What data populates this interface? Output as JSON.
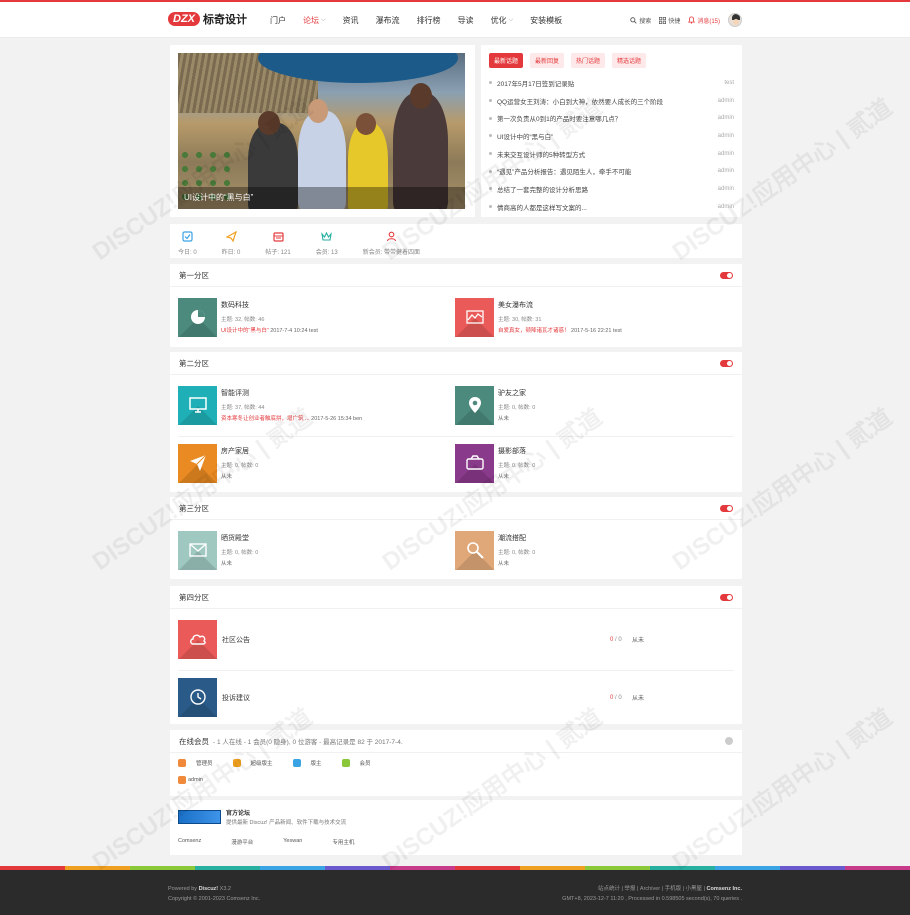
{
  "brand": {
    "badge": "DZX",
    "name": "标奇设计"
  },
  "nav": [
    {
      "label": "门户",
      "active": false,
      "caret": false
    },
    {
      "label": "论坛",
      "active": true,
      "caret": true
    },
    {
      "label": "资讯",
      "active": false,
      "caret": false
    },
    {
      "label": "瀑布流",
      "active": false,
      "caret": false
    },
    {
      "label": "排行榜",
      "active": false,
      "caret": false
    },
    {
      "label": "导读",
      "active": false,
      "caret": false
    },
    {
      "label": "优化",
      "active": false,
      "caret": true
    },
    {
      "label": "安装模板",
      "active": false,
      "caret": false
    }
  ],
  "header_right": {
    "search": "搜索",
    "quick": "快捷",
    "messages": "消息(15)"
  },
  "slide": {
    "caption": "UI设计中的“黑与白”"
  },
  "hot": {
    "tabs": [
      "最新话题",
      "最新回复",
      "热门话题",
      "精选话题"
    ],
    "items": [
      {
        "title": "2017年5月17日签到记录贴",
        "author": "test"
      },
      {
        "title": "QQ运营女王刘涛：小白到大神，依然要人成长的三个阶段",
        "author": "admin"
      },
      {
        "title": "第一次负责从0到1的产品时要注意哪几点？",
        "author": "admin"
      },
      {
        "title": "UI设计中的“黑与白”",
        "author": "admin"
      },
      {
        "title": "未来交互设计师的5种转型方式",
        "author": "admin"
      },
      {
        "title": "“遇见”产品分析报告：遇见陌生人，牵手不可能",
        "author": "admin"
      },
      {
        "title": "总结了一套完整的设计分析思路",
        "author": "admin"
      },
      {
        "title": "情商高的人都是这样写文案的...",
        "author": "admin"
      }
    ]
  },
  "stats": [
    {
      "label": "今日: 0",
      "icon": "check-icon",
      "color": "#3aa3e3"
    },
    {
      "label": "昨日: 0",
      "icon": "paper-plane-icon",
      "color": "#f0a020"
    },
    {
      "label": "帖子: 121",
      "icon": "calendar-icon",
      "color": "#e4393c"
    },
    {
      "label": "会员: 13",
      "icon": "crown-icon",
      "color": "#27b0a0"
    },
    {
      "label": "新会员: 带带健着四面",
      "icon": "user-icon",
      "color": "#e4393c"
    }
  ],
  "sections": [
    {
      "title": "第一分区",
      "forums": [
        {
          "name": "数码科技",
          "stat": "主题: 32, 帖数: 46",
          "last_red": "UI设计中的“黑与白”",
          "last_rest": " 2017-7-4 10:24 test",
          "color": "#4c8a7e",
          "icon": "pie-chart-icon"
        },
        {
          "name": "美女瀑布流",
          "stat": "主题: 30, 帖数: 31",
          "last_red": "自爱真女，顿降诸瓦才诸惑！",
          "last_rest": " 2017-5-16 22:21 test",
          "color": "#e95a58",
          "icon": "line-chart-icon"
        }
      ]
    },
    {
      "title": "第二分区",
      "forums": [
        {
          "name": "智能评测",
          "stat": "主题: 37, 帖数: 44",
          "last_red": "资本寒冬让创业者触底拼，增广筑 ...",
          "last_rest": " 2017-5-26 15:34 ben",
          "color": "#1fb0b7",
          "icon": "monitor-icon"
        },
        {
          "name": "驴友之家",
          "stat": "主题: 0, 帖数: 0",
          "last_red": "",
          "last_rest": "从未",
          "color": "#4c8a7e",
          "icon": "map-pin-icon"
        },
        {
          "name": "房产家居",
          "stat": "主题: 0, 帖数: 0",
          "last_red": "",
          "last_rest": "从未",
          "color": "#e98a22",
          "icon": "send-icon"
        },
        {
          "name": "摄影部落",
          "stat": "主题: 0, 帖数: 0",
          "last_red": "",
          "last_rest": "从未",
          "color": "#8a3a8a",
          "icon": "camera-icon"
        }
      ]
    },
    {
      "title": "第三分区",
      "forums": [
        {
          "name": "晒货殿堂",
          "stat": "主题: 0, 帖数: 0",
          "last_red": "",
          "last_rest": "从未",
          "color": "#9ec8c0",
          "icon": "mail-icon"
        },
        {
          "name": "潮流搭配",
          "stat": "主题: 0, 帖数: 0",
          "last_red": "",
          "last_rest": "从未",
          "color": "#e0a878",
          "icon": "search-icon"
        }
      ]
    },
    {
      "title": "第四分区",
      "forums": [
        {
          "name": "社区公告",
          "count": "0",
          "count2": "0",
          "last": "从未",
          "color": "#e95a58",
          "icon": "cloud-icon"
        },
        {
          "name": "投诉建议",
          "count": "0",
          "count2": "0",
          "last": "从未",
          "color": "#2a5a88",
          "icon": "clock-icon"
        }
      ]
    }
  ],
  "online": {
    "title": "在线会员",
    "summary": "- 1 人在线 - 1 会员(0 隐身), 0 位游客 - 最高记录是 82 于 2017-7-4.",
    "legend": [
      {
        "label": "管理员",
        "color": "#f08a3a"
      },
      {
        "label": "超级版主",
        "color": "#f0a020"
      },
      {
        "label": "版主",
        "color": "#3aa3e3"
      },
      {
        "label": "会员",
        "color": "#8ac83a"
      }
    ],
    "user": "admin"
  },
  "links": {
    "title": "官方论坛",
    "desc": "提供最新 Discuz! 产品新闻、软件下载与技术交流",
    "list": [
      "Comsenz",
      "漫游平台",
      "Yeswan",
      "专用主机"
    ]
  },
  "footer": {
    "powered": "Powered by",
    "product": "Discuz!",
    "version": " X3.2",
    "copyright": "Copyright © 2001-2023 Comsenz Inc.",
    "right_links": "站点统计 | 举报 | Archiver | 手机版 | 小黑屋 |",
    "company": " Comsenz Inc.",
    "timing": "GMT+8, 2023-12-7 11:20 , Processed in 0.598505 second(s), 70 queries ."
  },
  "watermark": "DISCUZ!应用中心 | 贰道"
}
